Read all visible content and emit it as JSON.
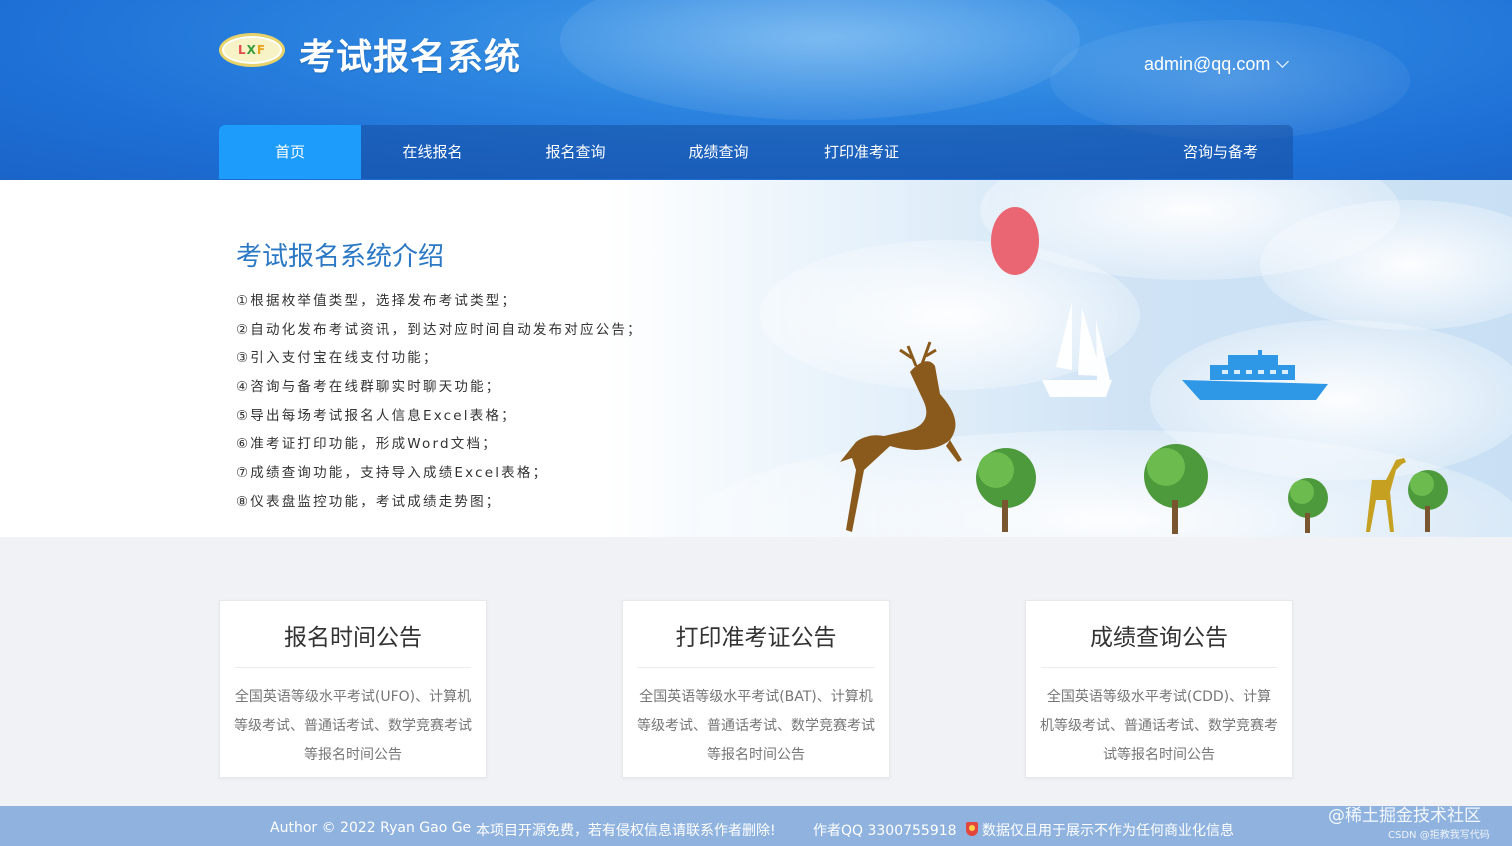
{
  "header": {
    "logo_text": [
      "L",
      "X",
      "F"
    ],
    "title": "考试报名系统",
    "user": "admin@qq.com"
  },
  "nav": [
    {
      "label": "首页",
      "active": true
    },
    {
      "label": "在线报名"
    },
    {
      "label": "报名查询"
    },
    {
      "label": "成绩查询"
    },
    {
      "label": "打印准考证"
    },
    {
      "label": "咨询与备考"
    }
  ],
  "intro": {
    "title": "考试报名系统介绍",
    "items": [
      "①根据枚举值类型，选择发布考试类型；",
      "②自动化发布考试资讯，到达对应时间自动发布对应公告；",
      "③引入支付宝在线支付功能；",
      "④咨询与备考在线群聊实时聊天功能；",
      "⑤导出每场考试报名人信息Excel表格；",
      "⑥准考证打印功能，形成Word文档；",
      "⑦成绩查询功能，支持导入成绩Excel表格；",
      "⑧仪表盘监控功能，考试成绩走势图；"
    ]
  },
  "cards": [
    {
      "title": "报名时间公告",
      "body": "全国英语等级水平考试(UFO)、计算机等级考试、普通话考试、数学竞赛考试等报名时间公告"
    },
    {
      "title": "打印准考证公告",
      "body": "全国英语等级水平考试(BAT)、计算机等级考试、普通话考试、数学竞赛考试等报名时间公告"
    },
    {
      "title": "成绩查询公告",
      "body": "全国英语等级水平考试(CDD)、计算机等级考试、普通话考试、数学竞赛考试等报名时间公告"
    }
  ],
  "footer": {
    "author": "Author © 2022 Ryan Gao Ge",
    "notice": "本项目开源免费，若有侵权信息请联系作者删除!",
    "qq": "作者QQ 3300755918",
    "disclaimer": "数据仅且用于展示不作为任何商业化信息"
  },
  "watermark": {
    "main": "@稀土掘金技术社区",
    "sub": "CSDN @拒教我写代码"
  },
  "colors": {
    "header_blue": "#1e70d6",
    "nav_active": "#1e9cfb",
    "intro_title": "#2b78c5",
    "footer": "#8fb3de"
  }
}
